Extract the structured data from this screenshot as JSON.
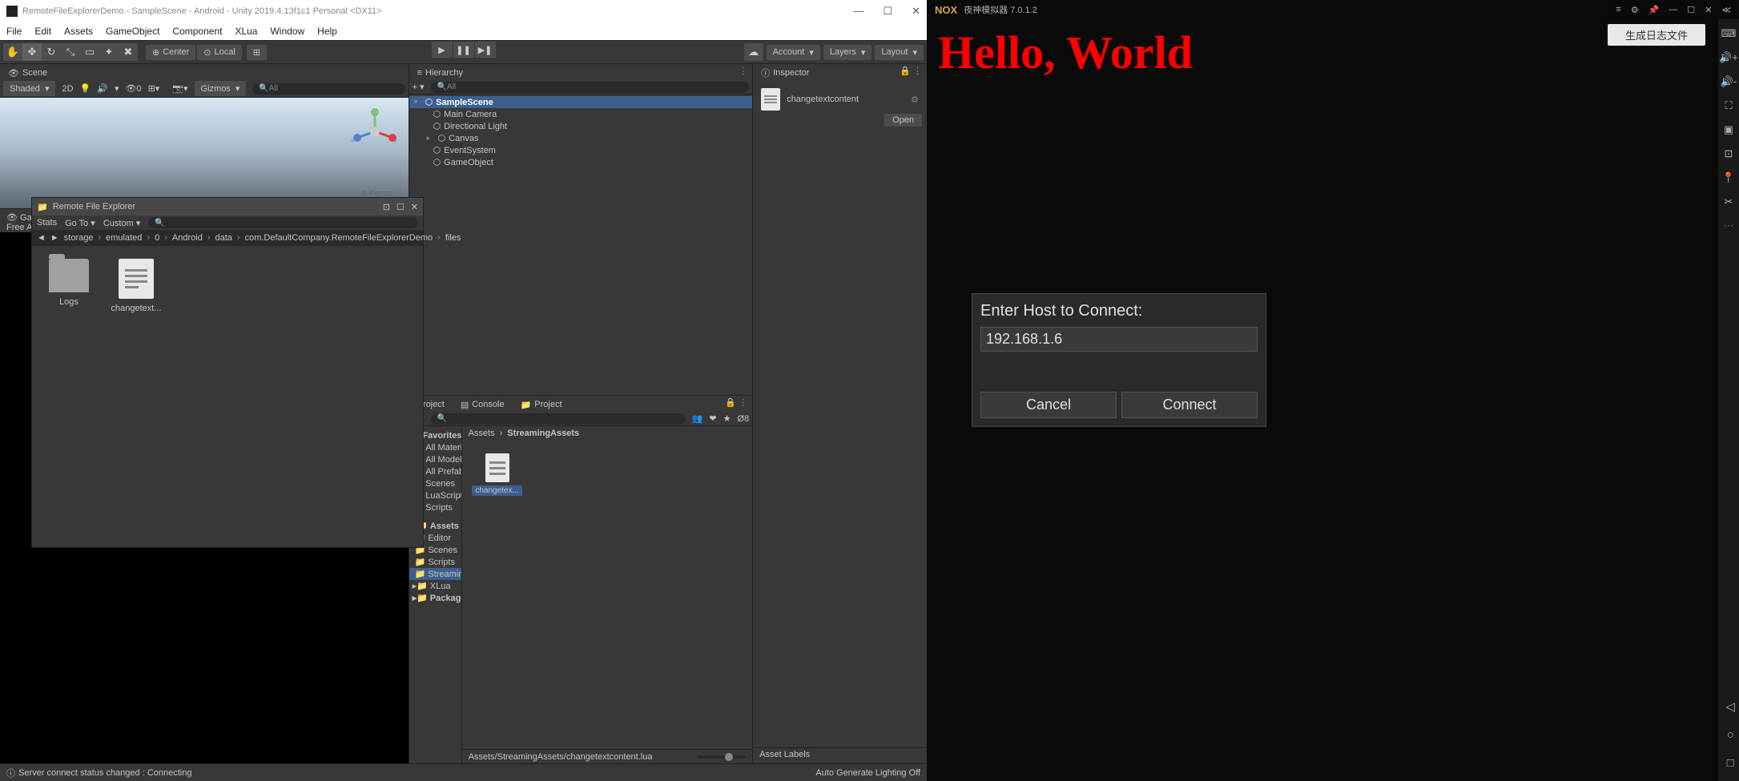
{
  "unity": {
    "title": "RemoteFileExplorerDemo - SampleScene - Android - Unity 2019.4.13f1c1 Personal <DX11>",
    "menu": [
      "File",
      "Edit",
      "Assets",
      "GameObject",
      "Component",
      "XLua",
      "Window",
      "Help"
    ],
    "toolbar": {
      "pivot_center": "Center",
      "pivot_local": "Local",
      "account": "Account",
      "layers": "Layers",
      "layout": "Layout"
    },
    "scene": {
      "tab": "Scene",
      "shaded": "Shaded",
      "mode_2d": "2D",
      "gizmos": "Gizmos",
      "search_placeholder": "All",
      "persp": "Persp"
    },
    "hierarchy": {
      "tab": "Hierarchy",
      "search_placeholder": "All",
      "scene_name": "SampleScene",
      "items": [
        "Main Camera",
        "Directional Light",
        "Canvas",
        "EventSystem",
        "GameObject"
      ]
    },
    "game": {
      "tab": "Game",
      "aspect": "Free Aspe"
    },
    "rfe": {
      "title": "Remote File Explorer",
      "stats": "Stats",
      "goto": "Go To",
      "custom": "Custom",
      "breadcrumb": [
        "storage",
        "emulated",
        "0",
        "Android",
        "data",
        "com.DefaultCompany.RemoteFileExplorerDemo",
        "files"
      ],
      "files": [
        "Logs",
        "changetext..."
      ]
    },
    "project": {
      "tabs": [
        "Project",
        "Console",
        "Project"
      ],
      "favorites": "Favorites",
      "fav_items": [
        "All Materials",
        "All Models",
        "All Prefabs"
      ],
      "assets": "Assets",
      "asset_folders": [
        "Scenes",
        "LuaScripts",
        "Scripts",
        "Editor",
        "Scenes",
        "Scripts",
        "StreamingA",
        "XLua"
      ],
      "packages": "Packages",
      "breadcrumb": [
        "Assets",
        "StreamingAssets"
      ],
      "file": "changetex...",
      "footer_path": "Assets/StreamingAssets/changetextcontent.lua",
      "asset_labels": "Asset Labels",
      "hidden_count": "8"
    },
    "inspector": {
      "tab": "Inspector",
      "asset_name": "changetextcontent",
      "open": "Open"
    },
    "status": {
      "left": "Server connect status changed : Connecting",
      "right": "Auto Generate Lighting Off"
    }
  },
  "nox": {
    "title": "夜神模拟器 7.0.1.2",
    "logo": "NOX",
    "hello": "Hello, World",
    "gen_log": "生成日志文件",
    "dialog": {
      "title": "Enter Host to Connect:",
      "value": "192.168.1.6",
      "cancel": "Cancel",
      "connect": "Connect"
    }
  }
}
